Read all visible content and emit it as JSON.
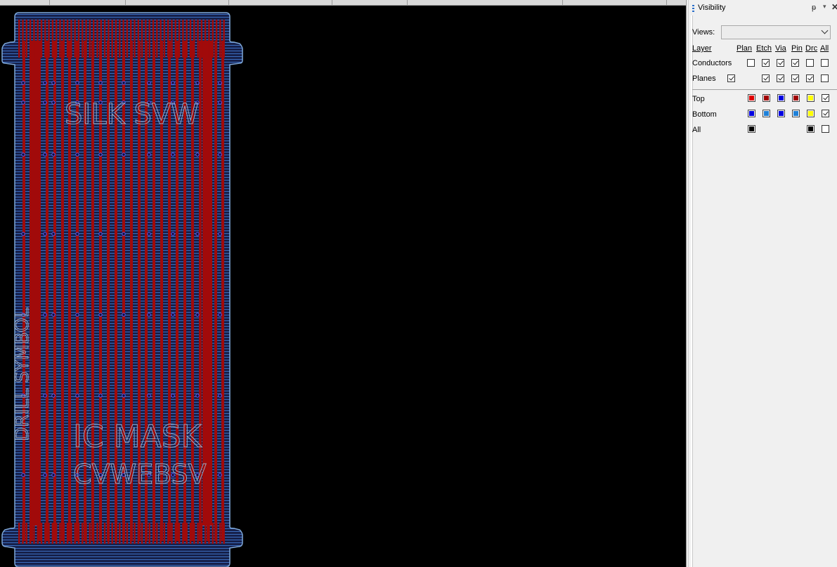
{
  "panel": {
    "title": "Visibility",
    "pin_glyph": "ᵽ",
    "menu_glyph": "▾",
    "close_glyph": "✕",
    "views_label": "Views:",
    "views_value": ""
  },
  "columns": [
    "Layer",
    "Plan",
    "Etch",
    "Via",
    "Pin",
    "Drc",
    "All"
  ],
  "global_rows": [
    {
      "label": "Conductors",
      "plan": false,
      "etch": true,
      "via": true,
      "pin": true,
      "drc": false,
      "all": false
    },
    {
      "label": "Planes",
      "planes_check": true,
      "etch": true,
      "via": true,
      "pin": true,
      "drc": true,
      "all": false
    }
  ],
  "layers": [
    {
      "label": "Top",
      "colors": [
        "#e00000",
        "#a00000",
        "#0000e0",
        "#a00000",
        "#ffff00"
      ],
      "all": true
    },
    {
      "label": "Bottom",
      "colors": [
        "#0000e0",
        "#1e80d8",
        "#0000e0",
        "#1e80d8",
        "#ffff00"
      ],
      "all": true
    },
    {
      "label": "All",
      "colors": [
        "#000000"
      ],
      "drc_color": "#000000",
      "all": false
    }
  ],
  "colors": {
    "board_outline": "#7fa8d8",
    "board_fill": "#16204a",
    "hatch": "#3c6ec0",
    "top_trace": "#a10a0a",
    "via_ring": "#5a5aff",
    "canvas": "#000000"
  },
  "board_text": {
    "silk_top": "SILK SVW",
    "silk_mid": "DRILL SYMBOL",
    "silk_bottom_1": "IC MASK",
    "silk_bottom_2": "CVWEBSV"
  }
}
